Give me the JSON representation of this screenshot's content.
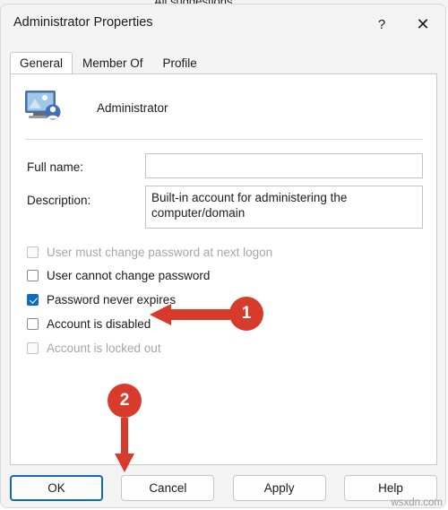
{
  "background_window": {
    "partial_title": "All suggestions"
  },
  "dialog": {
    "title": "Administrator Properties",
    "titlebar_buttons": [
      {
        "name": "help",
        "glyph": "?"
      },
      {
        "name": "close",
        "glyph": "✕"
      }
    ],
    "tabs": [
      {
        "label": "General",
        "active": true
      },
      {
        "label": "Member Of",
        "active": false
      },
      {
        "label": "Profile",
        "active": false
      }
    ],
    "account": {
      "icon": "user-account-icon",
      "name": "Administrator"
    },
    "fields": [
      {
        "label": "Full name:",
        "value": "",
        "placeholder": ""
      },
      {
        "label": "Description:",
        "value": "Built-in account for administering the computer/domain"
      }
    ],
    "checkboxes": [
      {
        "label": "User must change password at next logon",
        "checked": false,
        "disabled": true
      },
      {
        "label": "User cannot change password",
        "checked": false,
        "disabled": false
      },
      {
        "label": "Password never expires",
        "checked": true,
        "disabled": false
      },
      {
        "label": "Account is disabled",
        "checked": false,
        "disabled": false
      },
      {
        "label": "Account is locked out",
        "checked": false,
        "disabled": true
      }
    ],
    "buttons": [
      {
        "label": "OK",
        "primary": true
      },
      {
        "label": "Cancel",
        "primary": false
      },
      {
        "label": "Apply",
        "primary": false
      },
      {
        "label": "Help",
        "primary": false
      }
    ]
  },
  "annotations": {
    "accent_color": "#d83a2b",
    "steps": [
      {
        "number": "1",
        "points_to": "Account is disabled"
      },
      {
        "number": "2",
        "points_to": "OK"
      }
    ]
  },
  "watermark": "wsxdn.com"
}
